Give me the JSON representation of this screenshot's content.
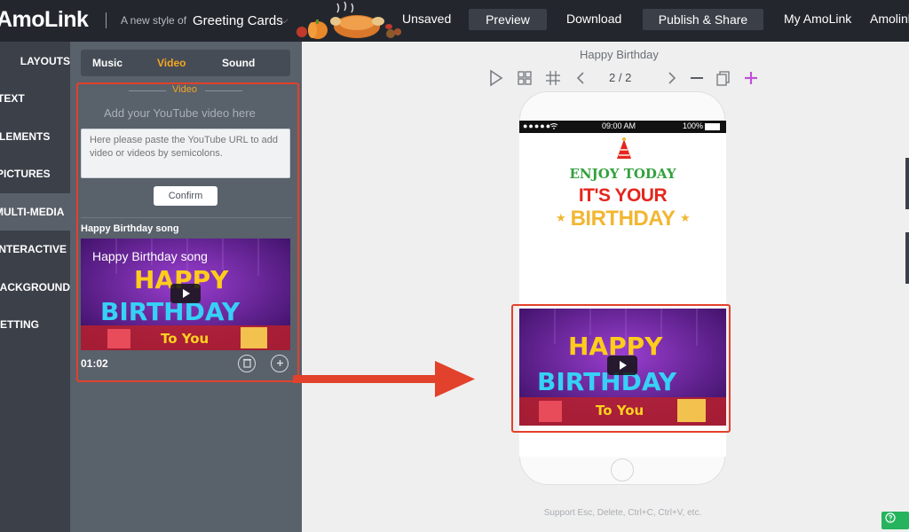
{
  "header": {
    "brand": "AmoLink",
    "tagline": "A new style of",
    "tagline_value": "Greeting Cards",
    "unsaved": "Unsaved",
    "preview": "Preview",
    "download": "Download",
    "publish": "Publish & Share",
    "my_amolink": "My AmoLink",
    "user": "Amolink"
  },
  "nav": {
    "items": [
      "LAYOUTS",
      "TEXT",
      "ELEMENTS",
      "PICTURES",
      "MULTI-MEDIA",
      "INTERACTIVE",
      "BACKGROUND",
      "SETTING"
    ],
    "active_index": 4
  },
  "panel": {
    "tabs": [
      "Music",
      "Video",
      "Sound"
    ],
    "active_tab": "Video",
    "section_title": "Video",
    "add_label": "Add your YouTube video here",
    "url_placeholder": "Here please paste the YouTube URL to add video or videos by semicolons.",
    "confirm_label": "Confirm",
    "song_title": "Happy Birthday song",
    "thumb_caption": "Happy Birthday song",
    "duration": "01:02"
  },
  "canvas": {
    "page_name": "Happy Birthday",
    "page_current": "2",
    "page_total": "2",
    "status_time": "09:00 AM",
    "status_battery": "100%",
    "card_line1": "ENJOY TODAY",
    "card_line2": "IT'S YOUR",
    "card_line3": "BIRTHDAY",
    "support_text": "Support Esc, Delete, Ctrl+C, Ctrl+V, etc."
  },
  "thumb_art": {
    "word1": "HAPPY",
    "word2": "BIRTHDAY",
    "word3": "To You"
  },
  "colors": {
    "accent": "#f5a623",
    "highlight": "#e2412b",
    "plus": "#c04fd8"
  }
}
